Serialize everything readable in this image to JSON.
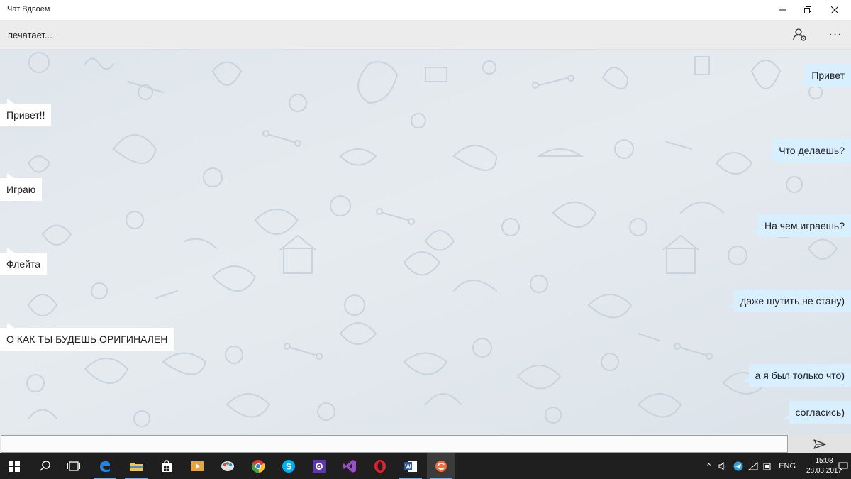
{
  "window": {
    "title": "Чат Вдвоем"
  },
  "header": {
    "status": "печатает..."
  },
  "messages": [
    {
      "dir": "out",
      "text": "Привет"
    },
    {
      "dir": "in",
      "text": "Привет!!"
    },
    {
      "dir": "out",
      "text": "Что делаешь?"
    },
    {
      "dir": "in",
      "text": "Играю"
    },
    {
      "dir": "out",
      "text": "На чем играешь?"
    },
    {
      "dir": "in",
      "text": "Флейта"
    },
    {
      "dir": "out",
      "text": "даже шутить не стану)"
    },
    {
      "dir": "in",
      "text": "О КАК ТЫ БУДЕШЬ ОРИГИНАЛЕН"
    },
    {
      "dir": "out",
      "text": "а я был только что)"
    },
    {
      "dir": "out",
      "text": "согласись)"
    }
  ],
  "composer": {
    "value": "",
    "placeholder": ""
  },
  "taskbar": {
    "apps": [
      {
        "icon": "start-icon"
      },
      {
        "icon": "search-icon"
      },
      {
        "icon": "task-view-icon"
      },
      {
        "icon": "edge-icon"
      },
      {
        "icon": "file-explorer-icon"
      },
      {
        "icon": "store-icon"
      },
      {
        "icon": "media-player-icon"
      },
      {
        "icon": "paint-icon"
      },
      {
        "icon": "chrome-icon"
      },
      {
        "icon": "skype-icon"
      },
      {
        "icon": "settings-app-icon"
      },
      {
        "icon": "visual-studio-icon"
      },
      {
        "icon": "opera-icon"
      },
      {
        "icon": "word-icon"
      },
      {
        "icon": "chat-app-icon"
      }
    ],
    "language": "ENG",
    "time": "15:08",
    "date": "28.03.2017"
  },
  "colors": {
    "incoming_bubble": "#ffffff",
    "outgoing_bubble": "#d8efff",
    "taskbar": "#1f1f1f",
    "header": "#ececec"
  }
}
